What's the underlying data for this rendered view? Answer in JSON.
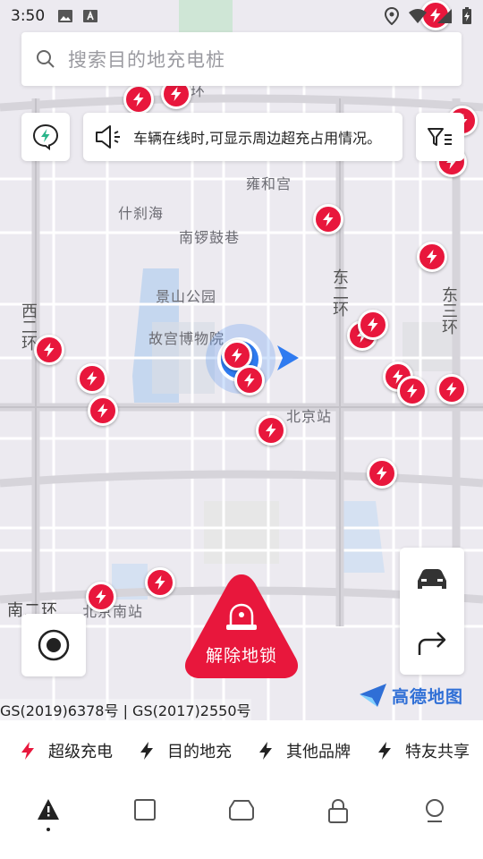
{
  "status_bar": {
    "time": "3:50",
    "icons": [
      "image-icon",
      "text-icon",
      "location-icon",
      "wifi-icon",
      "signal-icon",
      "battery-charging-icon"
    ]
  },
  "search": {
    "placeholder": "搜索目的地充电桩"
  },
  "notice": {
    "text": "车辆在线时,可显示周边超充占用情况。"
  },
  "map": {
    "labels": [
      "二环",
      "雍和宫",
      "什刹海",
      "南锣鼓巷",
      "景山公园",
      "故宫博物院",
      "北京站",
      "北京南站",
      "南二环"
    ],
    "vertical_labels": [
      "西二环",
      "东二环",
      "东三环"
    ],
    "logo_text": "高德地图",
    "copyright": "GS(2019)6378号 | GS(2017)2550号",
    "pin_color": "#e8173c"
  },
  "unlock_button": {
    "label": "解除地锁"
  },
  "legend": {
    "items": [
      {
        "label": "超级充电",
        "color": "#e8173c"
      },
      {
        "label": "目的地充",
        "color": "#222222"
      },
      {
        "label": "其他品牌",
        "color": "#222222"
      },
      {
        "label": "特友共享",
        "color": "#222222"
      }
    ]
  },
  "bottom_nav": {
    "items": [
      "navigation-icon",
      "square-icon",
      "car-icon",
      "lock-icon",
      "profile-icon"
    ],
    "active_index": 0
  },
  "colors": {
    "accent": "#e8173c",
    "logo_blue": "#2f6fd6"
  }
}
